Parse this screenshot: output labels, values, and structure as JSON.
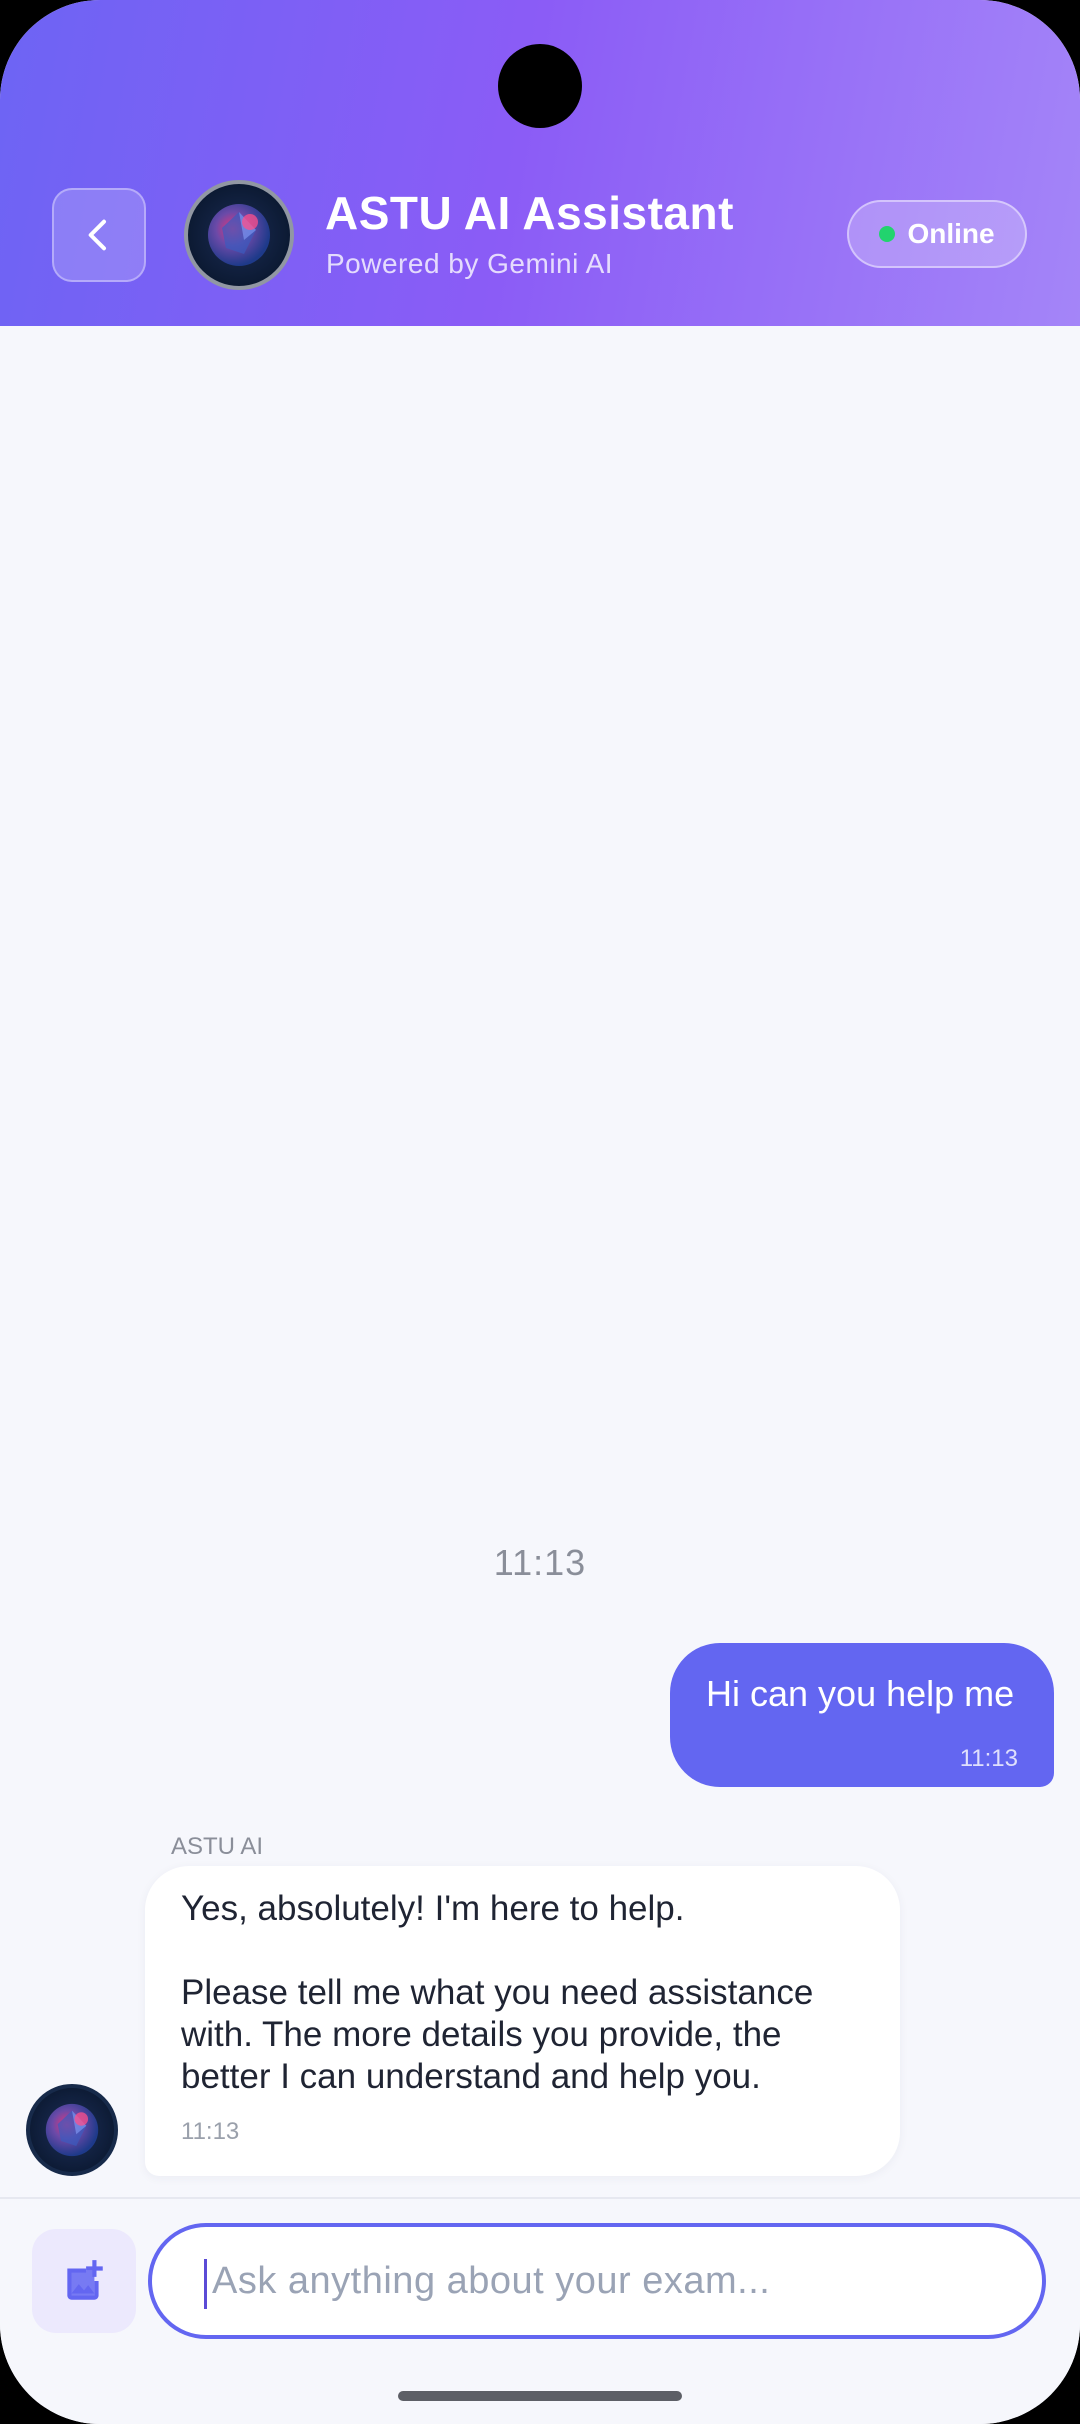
{
  "header": {
    "title": "ASTU AI Assistant",
    "subtitle": "Powered by Gemini AI",
    "status": "Online",
    "accent": "#6366f1",
    "status_color": "#22d36e"
  },
  "messages": [
    {
      "sender": "user",
      "text": "Hi can you help me",
      "time": "11:13"
    },
    {
      "sender": "bot",
      "name": "ASTU AI",
      "paragraphs": [
        "Yes, absolutely! I'm here to help.",
        "Please tell me what you need assistance with. The more details you provide, the better I can understand and help you."
      ],
      "time": "11:13"
    }
  ],
  "time_separator": "11:13",
  "input": {
    "placeholder": "Ask anything about your exam...",
    "value": ""
  },
  "icons": {
    "back": "chevron-left-icon",
    "image_upload": "add-photo-icon"
  }
}
